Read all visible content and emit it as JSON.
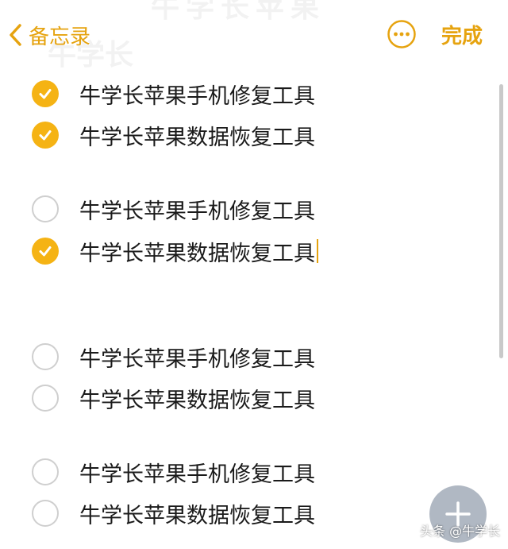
{
  "nav": {
    "back_label": "备忘录",
    "done_label": "完成"
  },
  "ghost": {
    "top_text": "牛学长苹果",
    "left_text": "牛学长"
  },
  "checklist": [
    {
      "text": "牛学长苹果手机修复工具",
      "checked": true
    },
    {
      "text": "牛学长苹果数据恢复工具",
      "checked": true
    },
    {
      "text": "牛学长苹果手机修复工具",
      "checked": false
    },
    {
      "text": "牛学长苹果数据恢复工具",
      "checked": true,
      "editing": true
    },
    {
      "text": "牛学长苹果手机修复工具",
      "checked": false
    },
    {
      "text": "牛学长苹果数据恢复工具",
      "checked": false
    },
    {
      "text": "牛学长苹果手机修复工具",
      "checked": false
    },
    {
      "text": "牛学长苹果数据恢复工具",
      "checked": false
    }
  ],
  "watermark": "头条 @牛学长",
  "colors": {
    "accent": "#e6a30f",
    "check_fill": "#f5b314",
    "unchecked_border": "#cfcfcf"
  },
  "icons": {
    "back": "chevron-left-icon",
    "more": "ellipsis-circle-icon",
    "check": "checkmark-icon",
    "add": "plus-icon"
  }
}
